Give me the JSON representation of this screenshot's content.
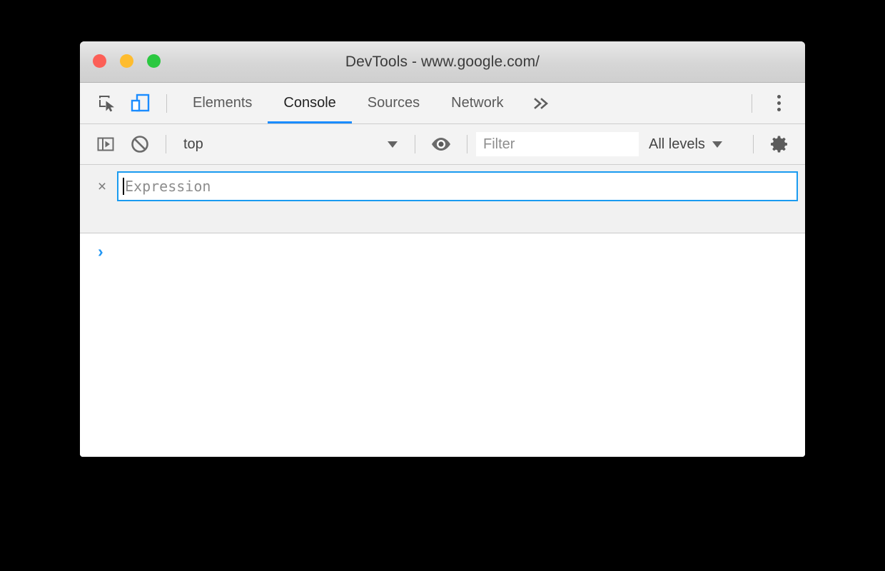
{
  "window": {
    "title": "DevTools - www.google.com/",
    "traffic_lights": [
      {
        "name": "close",
        "color": "#fc5f57"
      },
      {
        "name": "minimize",
        "color": "#febc2e"
      },
      {
        "name": "maximize",
        "color": "#2bc840"
      }
    ]
  },
  "tabbar": {
    "inspect_icon": "inspect-element-icon",
    "device_icon": "device-toolbar-icon",
    "device_icon_color": "#1a8cff",
    "tabs": [
      {
        "label": "Elements",
        "active": false
      },
      {
        "label": "Console",
        "active": true
      },
      {
        "label": "Sources",
        "active": false
      },
      {
        "label": "Network",
        "active": false
      }
    ],
    "more_tabs_label": "»",
    "main_menu_icon": "three-dots-vertical-icon",
    "active_tab_underline_color": "#1a8cff"
  },
  "console_toolbar": {
    "sidebar_toggle_icon": "console-sidebar-icon",
    "clear_console_icon": "clear-console-icon",
    "context_value": "top",
    "context_caret": "▼",
    "live_expression_icon": "eye-icon",
    "filter_placeholder": "Filter",
    "filter_value": "",
    "levels_label": "All levels",
    "levels_caret": "▼",
    "settings_icon": "gear-icon"
  },
  "live_expression": {
    "close_label": "×",
    "placeholder": "Expression",
    "value": "",
    "focused": true,
    "focus_border_color": "#1a9bf0"
  },
  "console_output": {
    "prompt_symbol": "›",
    "prompt_color": "#2196f3",
    "entries": []
  }
}
